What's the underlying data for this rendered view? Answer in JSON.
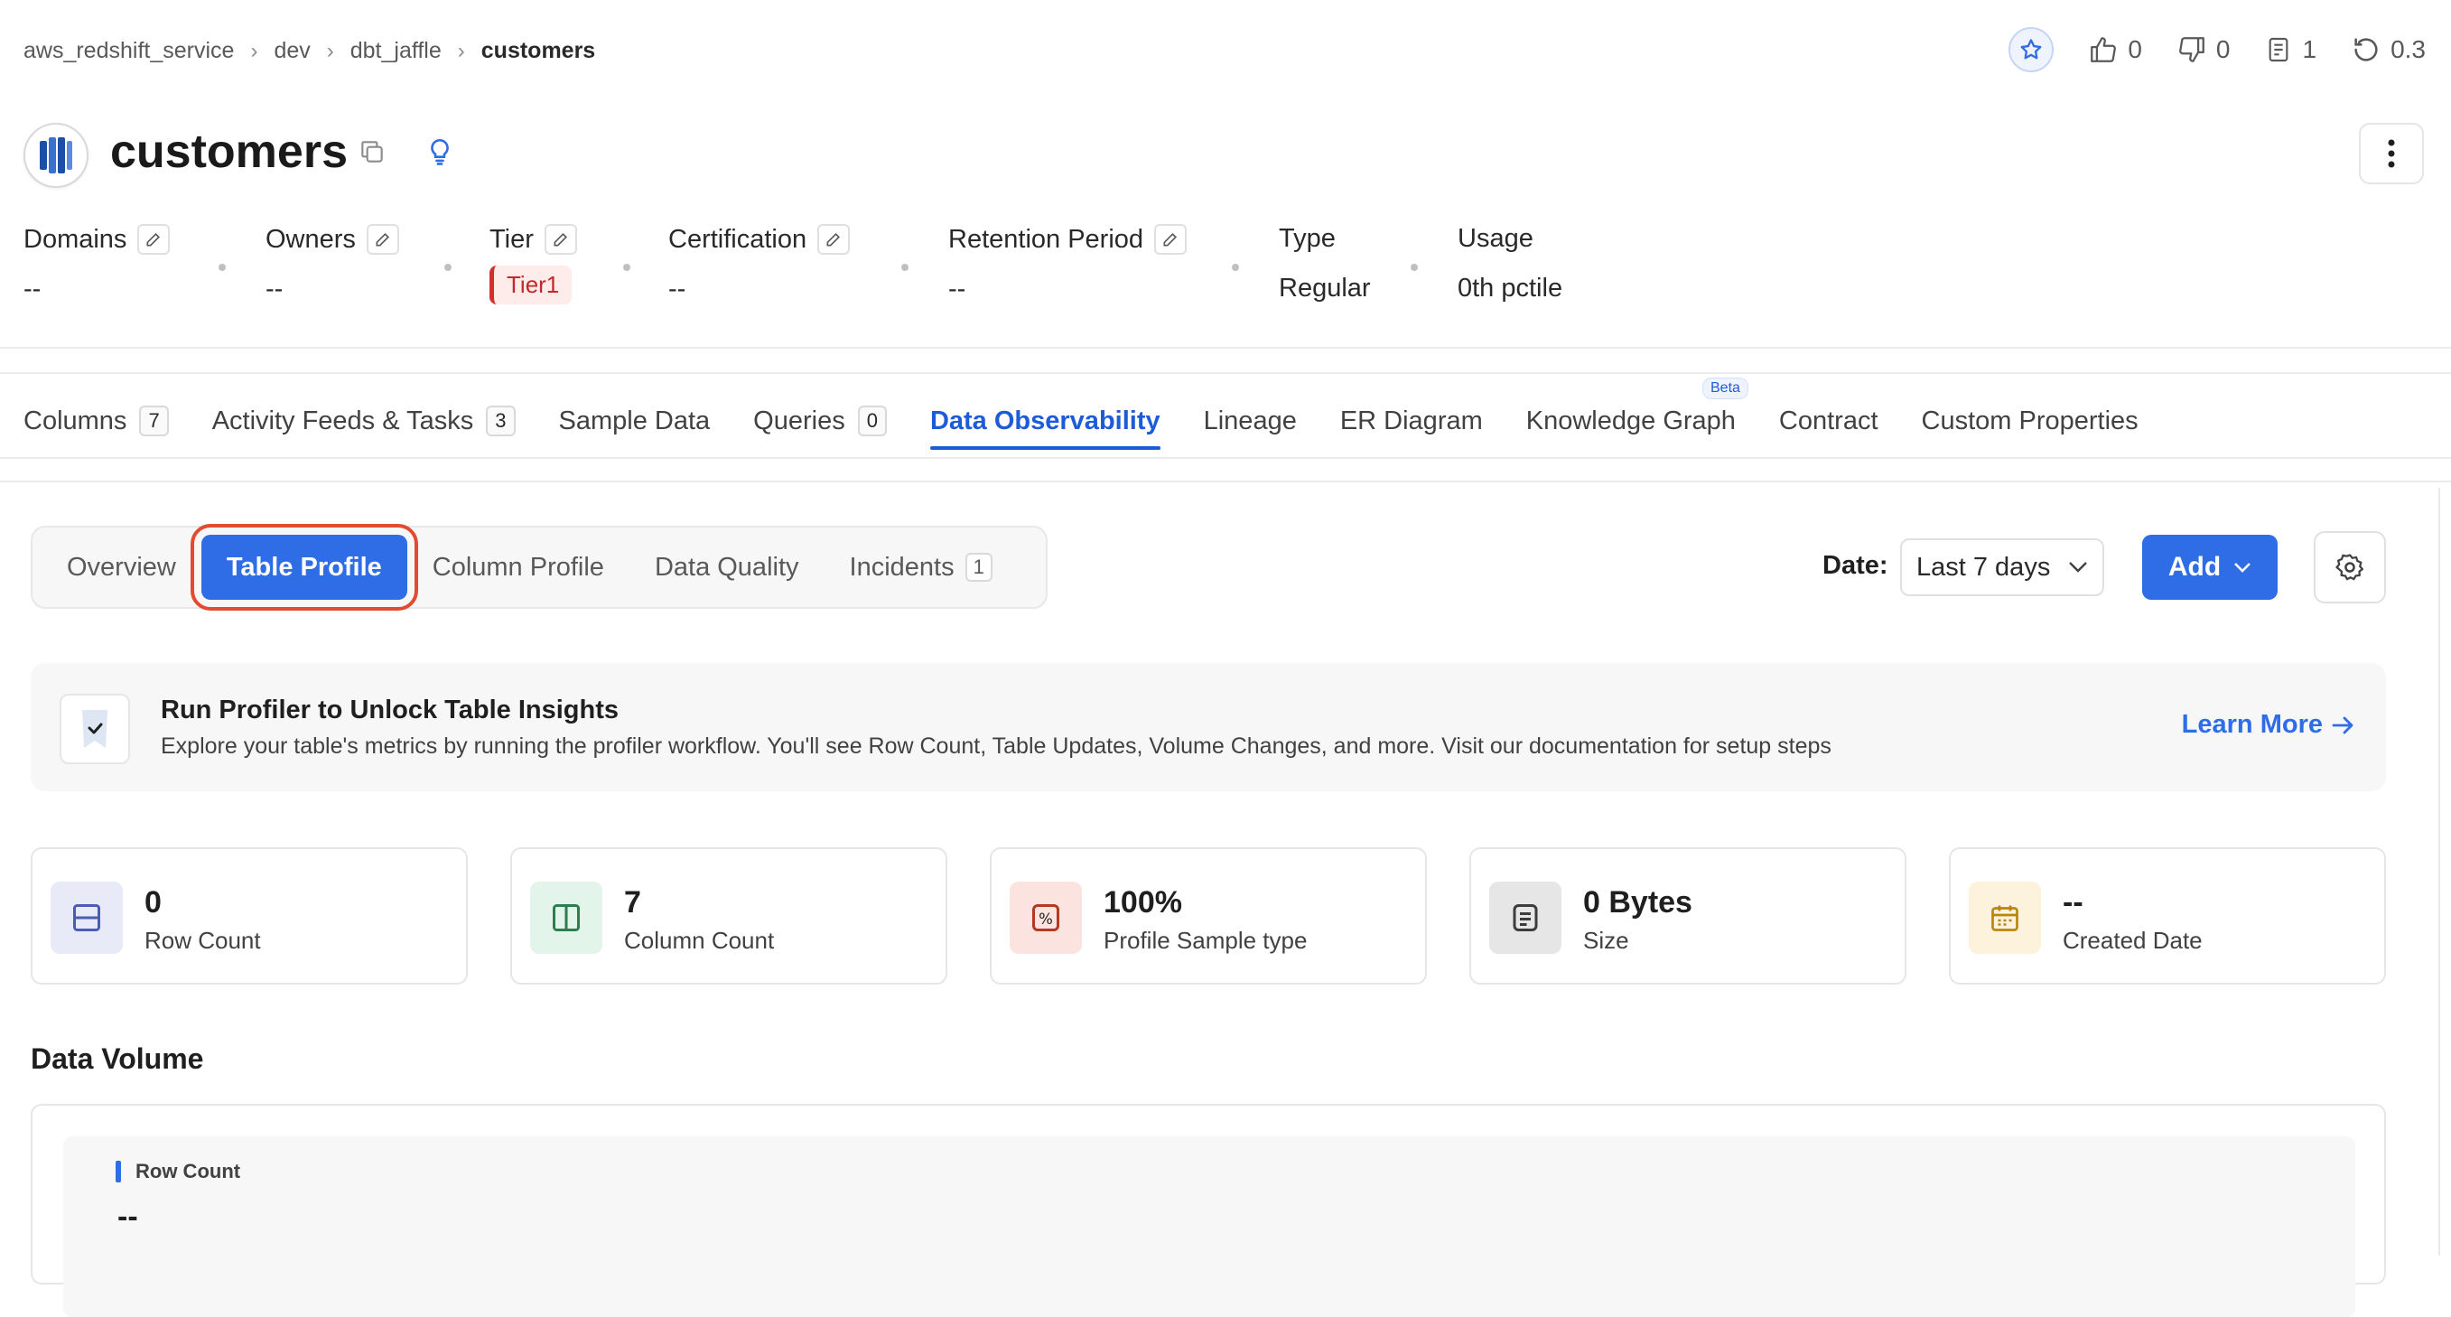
{
  "breadcrumb": [
    "aws_redshift_service",
    "dev",
    "dbt_jaffle",
    "customers"
  ],
  "top_actions": {
    "likes": "0",
    "dislikes": "0",
    "docs": "1",
    "version": "0.3"
  },
  "entity": {
    "title": "customers"
  },
  "meta": {
    "domains": {
      "label": "Domains",
      "value": "--"
    },
    "owners": {
      "label": "Owners",
      "value": "--"
    },
    "tier": {
      "label": "Tier",
      "value": "Tier1"
    },
    "certification": {
      "label": "Certification",
      "value": "--"
    },
    "retention": {
      "label": "Retention Period",
      "value": "--"
    },
    "type": {
      "label": "Type",
      "value": "Regular"
    },
    "usage": {
      "label": "Usage",
      "value": "0th pctile"
    }
  },
  "tabs": [
    {
      "label": "Columns",
      "count": "7"
    },
    {
      "label": "Activity Feeds & Tasks",
      "count": "3"
    },
    {
      "label": "Sample Data"
    },
    {
      "label": "Queries",
      "count": "0"
    },
    {
      "label": "Data Observability",
      "active": true
    },
    {
      "label": "Lineage"
    },
    {
      "label": "ER Diagram"
    },
    {
      "label": "Knowledge Graph",
      "badge": "Beta"
    },
    {
      "label": "Contract"
    },
    {
      "label": "Custom Properties"
    }
  ],
  "subtabs": [
    {
      "label": "Overview"
    },
    {
      "label": "Table Profile",
      "selected": true
    },
    {
      "label": "Column Profile"
    },
    {
      "label": "Data Quality"
    },
    {
      "label": "Incidents",
      "count": "1"
    }
  ],
  "controls": {
    "date_label": "Date:",
    "date_value": "Last 7 days",
    "add_label": "Add"
  },
  "banner": {
    "title": "Run Profiler to Unlock Table Insights",
    "description": "Explore your table's metrics by running the profiler workflow. You'll see Row Count, Table Updates, Volume Changes, and more. Visit our documentation for setup steps",
    "link": "Learn More"
  },
  "stats": [
    {
      "value": "0",
      "label": "Row Count",
      "icon": "row-count-icon",
      "bg": "#e8ebf7",
      "fg": "#4a5cb5"
    },
    {
      "value": "7",
      "label": "Column Count",
      "icon": "column-count-icon",
      "bg": "#e3f4ea",
      "fg": "#2e7d4f"
    },
    {
      "value": "100%",
      "label": "Profile Sample type",
      "icon": "percent-icon",
      "bg": "#fbe4df",
      "fg": "#b23a22"
    },
    {
      "value": "0 Bytes",
      "label": "Size",
      "icon": "size-icon",
      "bg": "#e6e6e6",
      "fg": "#3c3c3c"
    },
    {
      "value": "--",
      "label": "Created Date",
      "icon": "calendar-icon",
      "bg": "#fdf2dc",
      "fg": "#b8860b"
    }
  ],
  "data_volume": {
    "title": "Data Volume",
    "series_label": "Row Count",
    "value": "--"
  },
  "colors": {
    "primary": "#2f6de6",
    "highlight": "#e24b32"
  }
}
